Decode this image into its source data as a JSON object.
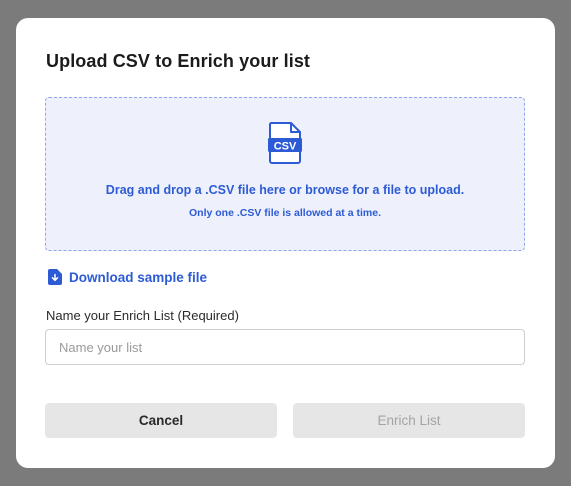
{
  "modal": {
    "title": "Upload CSV to Enrich your list"
  },
  "dropzone": {
    "icon": "csv-file-icon",
    "icon_text": "CSV",
    "primary_text": "Drag and drop a .CSV file here or browse for a file to upload.",
    "secondary_text": "Only one .CSV file is allowed at a time."
  },
  "download_link": {
    "icon": "file-download-icon",
    "label": "Download sample file"
  },
  "name_field": {
    "label": "Name your Enrich List (Required)",
    "value": "",
    "placeholder": "Name your list"
  },
  "actions": {
    "cancel_label": "Cancel",
    "enrich_label": "Enrich List"
  },
  "colors": {
    "accent": "#2d5bd6",
    "backdrop": "#7b7b7b",
    "dropzone_bg": "#eef1fb",
    "button_bg": "#e6e6e6"
  }
}
